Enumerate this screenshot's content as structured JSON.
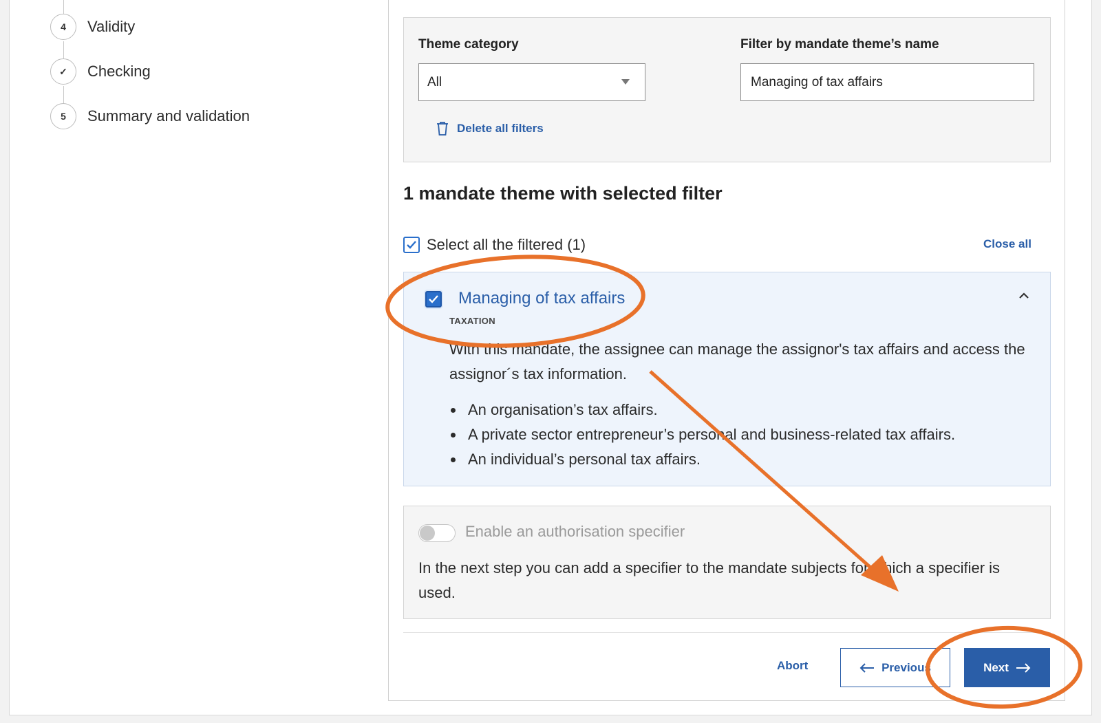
{
  "stepper": {
    "steps": [
      {
        "marker": "4",
        "label": "Validity"
      },
      {
        "marker": "✓",
        "label": "Checking"
      },
      {
        "marker": "5",
        "label": "Summary and validation"
      }
    ]
  },
  "filters": {
    "theme_category_label": "Theme category",
    "theme_category_value": "All",
    "name_filter_label": "Filter by mandate theme’s name",
    "name_filter_value": "Managing of tax affairs",
    "delete_all_label": "Delete all filters"
  },
  "results": {
    "title": "1 mandate theme with selected filter",
    "select_all_label": "Select all the filtered (1)",
    "close_all_label": "Close all"
  },
  "theme": {
    "title": "Managing of tax affairs",
    "category": "TAXATION",
    "description": "With this mandate, the assignee can manage the assignor's tax affairs and access the assignor´s tax information.",
    "items": [
      "An organisation’s tax affairs.",
      "A private sector entrepreneur’s personal and business-related tax affairs.",
      "An individual’s personal tax affairs."
    ]
  },
  "specifier": {
    "toggle_label": "Enable an authorisation specifier",
    "description": "In the next step you can add a specifier to the mandate subjects for which a specifier is used."
  },
  "actions": {
    "abort_label": "Abort",
    "previous_label": "Previous",
    "next_label": "Next"
  },
  "colors": {
    "accent": "#2a5ea8",
    "annotation": "#e8712a",
    "theme_panel_bg": "#eef4fc"
  }
}
